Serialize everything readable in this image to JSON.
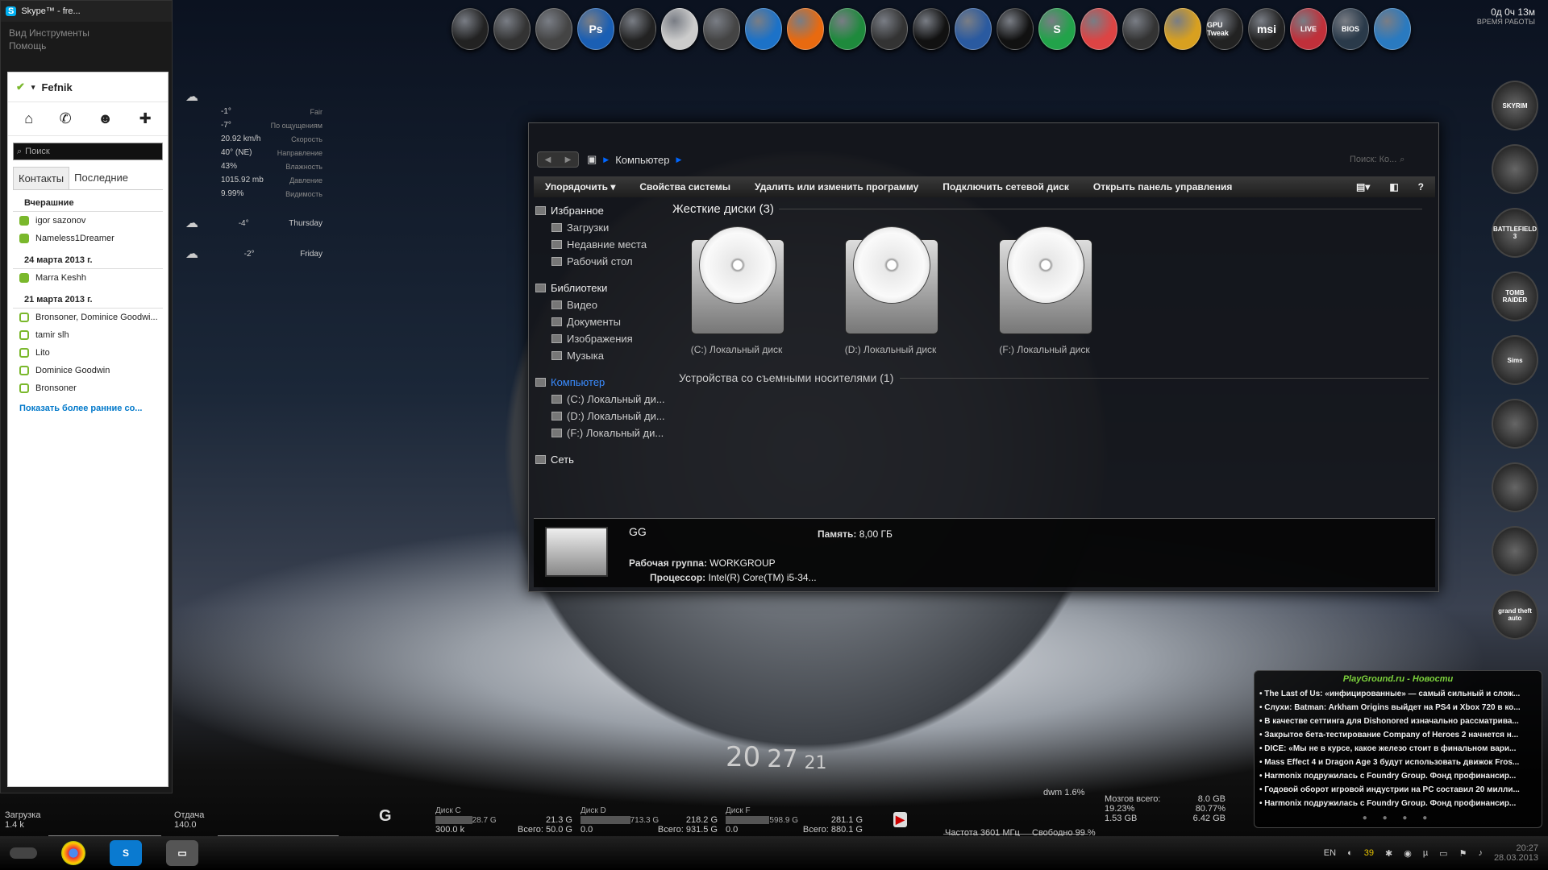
{
  "dock": {
    "icons": [
      {
        "label": "",
        "color": "#222"
      },
      {
        "label": "",
        "color": "#333"
      },
      {
        "label": "",
        "color": "#444"
      },
      {
        "label": "Ps",
        "color": "#1a5fb4"
      },
      {
        "label": "",
        "color": "#222"
      },
      {
        "label": "",
        "color": "#ccc"
      },
      {
        "label": "",
        "color": "#444"
      },
      {
        "label": "",
        "color": "#1c72c8"
      },
      {
        "label": "",
        "color": "#e86a10"
      },
      {
        "label": "",
        "color": "#1e8a3c"
      },
      {
        "label": "",
        "color": "#333"
      },
      {
        "label": "",
        "color": "#111"
      },
      {
        "label": "",
        "color": "#2a5aa0"
      },
      {
        "label": "",
        "color": "#111"
      },
      {
        "label": "S",
        "color": "#22a34a"
      },
      {
        "label": "",
        "color": "#d44"
      },
      {
        "label": "",
        "color": "#333"
      },
      {
        "label": "",
        "color": "#d8a020"
      },
      {
        "label": "GPU Tweak",
        "color": "#222"
      },
      {
        "label": "msi",
        "color": "#222"
      },
      {
        "label": "LIVE",
        "color": "#c0303a"
      },
      {
        "label": "BIOS",
        "color": "#2a3a4a"
      },
      {
        "label": "",
        "color": "#2a7ac0"
      }
    ],
    "uptime": "0д 0ч 13м",
    "uptime_label": "ВРЕМЯ РАБОТЫ"
  },
  "skype": {
    "title": "Skype™ - fre...",
    "menu": [
      "Вид Инструменты",
      "Помощь"
    ],
    "username": "Fefnik",
    "search_placeholder": "Поиск",
    "tabs": [
      "Контакты",
      "Последние"
    ],
    "groups": [
      {
        "title": "Вчерашние",
        "contacts": [
          {
            "name": "igor sazonov",
            "online": true
          },
          {
            "name": "Nameless1Dreamer",
            "online": true
          }
        ]
      },
      {
        "title": "24 марта 2013 г.",
        "contacts": [
          {
            "name": "Marra Keshh",
            "online": true
          }
        ]
      },
      {
        "title": "21 марта 2013 г.",
        "contacts": [
          {
            "name": "Bronsoner, Dominice Goodwi...",
            "online": false
          },
          {
            "name": "tamir slh",
            "online": false
          },
          {
            "name": "Lito",
            "online": false
          },
          {
            "name": "Dominice Goodwin",
            "online": false
          },
          {
            "name": "Bronsoner",
            "online": false
          }
        ]
      }
    ],
    "show_more": "Показать более ранние со..."
  },
  "weather": {
    "rows": [
      {
        "v": "-1°",
        "l": "Fair"
      },
      {
        "v": "-7°",
        "l": "По ощущениям"
      },
      {
        "v": "20.92 km/h",
        "l": "Скорость"
      },
      {
        "v": "40° (NE)",
        "l": "Направление"
      },
      {
        "v": "43%",
        "l": "Влажность"
      },
      {
        "v": "1015.92 mb",
        "l": "Давление"
      },
      {
        "v": "9.99%",
        "l": "Видимость"
      }
    ],
    "days": [
      {
        "t": "-4°",
        "d": "Thursday"
      },
      {
        "t": "-2°",
        "d": "Friday"
      }
    ]
  },
  "explorer": {
    "breadcrumb": "Компьютер",
    "search_placeholder": "Поиск: Ко...",
    "commands": [
      "Упорядочить ▾",
      "Свойства системы",
      "Удалить или изменить программу",
      "Подключить сетевой диск",
      "Открыть панель управления"
    ],
    "tree": [
      {
        "t": "Избранное",
        "sub": false,
        "sel": false
      },
      {
        "t": "Загрузки",
        "sub": true,
        "sel": false
      },
      {
        "t": "Недавние места",
        "sub": true,
        "sel": false
      },
      {
        "t": "Рабочий стол",
        "sub": true,
        "sel": false
      },
      {
        "t": "",
        "sub": false,
        "sel": false
      },
      {
        "t": "Библиотеки",
        "sub": false,
        "sel": false
      },
      {
        "t": "Видео",
        "sub": true,
        "sel": false
      },
      {
        "t": "Документы",
        "sub": true,
        "sel": false
      },
      {
        "t": "Изображения",
        "sub": true,
        "sel": false
      },
      {
        "t": "Музыка",
        "sub": true,
        "sel": false
      },
      {
        "t": "",
        "sub": false,
        "sel": false
      },
      {
        "t": "Компьютер",
        "sub": false,
        "sel": true
      },
      {
        "t": "(C:) Локальный ди...",
        "sub": true,
        "sel": false
      },
      {
        "t": "(D:) Локальный ди...",
        "sub": true,
        "sel": false
      },
      {
        "t": "(F:) Локальный ди...",
        "sub": true,
        "sel": false
      },
      {
        "t": "",
        "sub": false,
        "sel": false
      },
      {
        "t": "Сеть",
        "sub": false,
        "sel": false
      }
    ],
    "hdd_header": "Жесткие диски (3)",
    "drives": [
      "(C:) Локальный диск",
      "(D:) Локальный диск",
      "(F:) Локальный диск"
    ],
    "removable": "Устройства со съемными носителями (1)",
    "details": {
      "name": "GG",
      "mem_label": "Память:",
      "mem": "8,00 ГБ",
      "wg_label": "Рабочая группа:",
      "wg": "WORKGROUP",
      "cpu_label": "Процессор:",
      "cpu": "Intel(R) Core(TM) i5-34..."
    }
  },
  "games": [
    "SKYRIM",
    "",
    "BATTLEFIELD 3",
    "TOMB RAIDER",
    "Sims",
    "",
    "",
    "",
    "grand theft auto"
  ],
  "news": {
    "title": "PlayGround.ru - Новости",
    "items": [
      "The Last of Us: «инфицированные» — самый сильный и слож...",
      "Слухи: Batman: Arkham Origins выйдет на PS4 и Xbox 720 в ко...",
      "В качестве сеттинга для Dishonored изначально рассматрива...",
      "Закрытое бета-тестирование Company of Heroes 2 начнется н...",
      "DICE: «Мы не в курсе, какое железо стоит в финальном вари...",
      "Mass Effect 4 и Dragon Age 3 будут использовать движок Fros...",
      "Harmonix подружилась с Foundry Group. Фонд профинансир...",
      "Годовой оборот игровой индустрии на PC составил 20 милли...",
      "Harmonix подружилась с Foundry Group. Фонд профинансир..."
    ]
  },
  "bclock": {
    "h": "20",
    "m": "27",
    "s": "21"
  },
  "stats": {
    "dl_label": "Загрузка",
    "dl": "1.4 k",
    "ul_label": "Отдача",
    "ul": "140.0",
    "disks": [
      {
        "name": "Диск C",
        "used": "28.7 G",
        "free": "21.3 G",
        "rate": "300.0 k",
        "total": "Всего: 50.0 G",
        "bar": 0.57
      },
      {
        "name": "Диск D",
        "used": "713.3 G",
        "free": "218.2 G",
        "rate": "0.0",
        "total": "Всего: 931.5 G",
        "bar": 0.77
      },
      {
        "name": "Диск F",
        "used": "598.9 G",
        "free": "281.1 G",
        "rate": "0.0",
        "total": "Всего: 880.1 G",
        "bar": 0.68
      }
    ],
    "cpu_freq": "Частота 3601 МГц",
    "cpu_free": "Свободно 99 %",
    "dwm": "dwm 1.6%",
    "mem_label": "Мозгов всего:",
    "mem_total": "8.0 GB",
    "mem_used_pct": "19.23%",
    "mem_free_pct": "80.77%",
    "mem_used": "1.53 GB",
    "mem_free": "6.42 GB"
  },
  "taskbar": {
    "lang": "EN",
    "tray_num": "39",
    "time": "20:27",
    "date": "28.03.2013"
  }
}
